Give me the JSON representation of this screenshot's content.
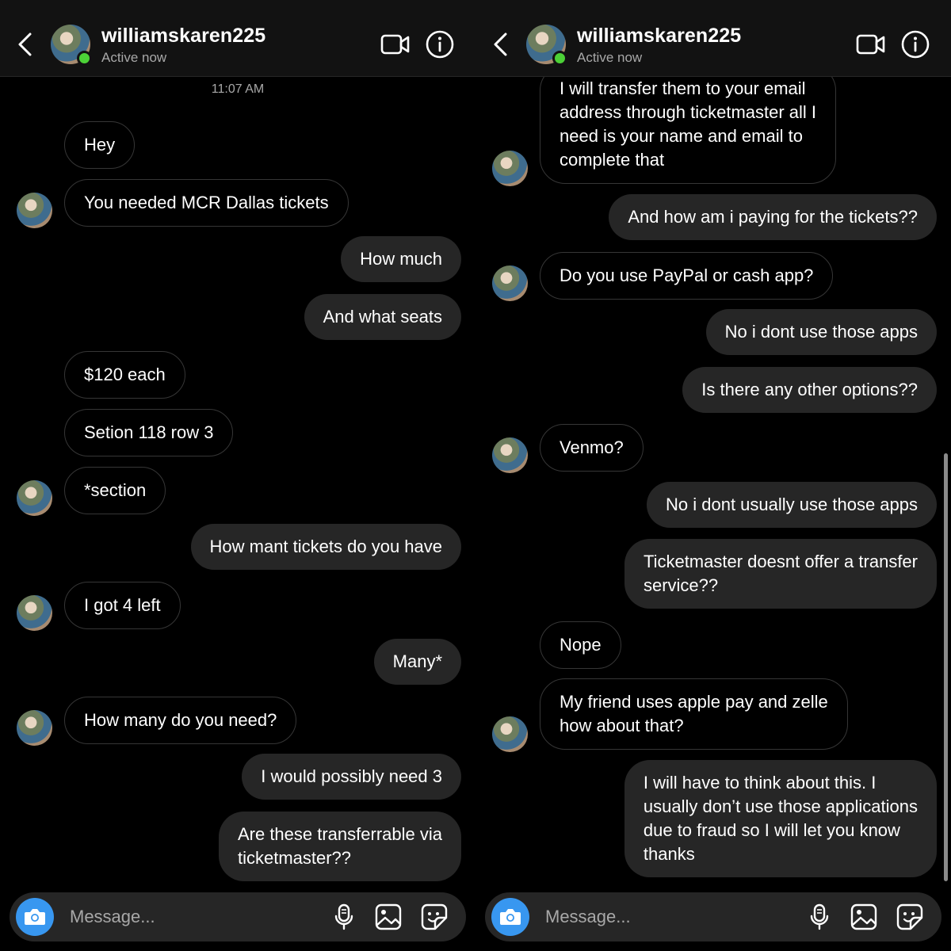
{
  "left": {
    "header": {
      "username": "williamskaren225",
      "status": "Active now"
    },
    "timestamp": "11:07 AM",
    "messages": [
      {
        "text": "Hey",
        "dir": "in"
      },
      {
        "text": "You needed MCR Dallas tickets",
        "dir": "in"
      },
      {
        "text": "How much",
        "dir": "out"
      },
      {
        "text": "And what seats",
        "dir": "out"
      },
      {
        "text": "$120 each",
        "dir": "in"
      },
      {
        "text": "Setion 118 row 3",
        "dir": "in"
      },
      {
        "text": "*section",
        "dir": "in"
      },
      {
        "text": "How mant tickets do you have",
        "dir": "out"
      },
      {
        "text": "I got 4 left",
        "dir": "in"
      },
      {
        "text": "Many*",
        "dir": "out"
      },
      {
        "text": "How many do you need?",
        "dir": "in"
      },
      {
        "text": "I would possibly need 3",
        "dir": "out"
      },
      {
        "text": "Are these transferrable via\nticketmaster??",
        "dir": "out"
      }
    ],
    "composer": {
      "placeholder": "Message..."
    }
  },
  "right": {
    "header": {
      "username": "williamskaren225",
      "status": "Active now"
    },
    "messages": [
      {
        "text": "I will transfer them to your email\naddress through ticketmaster all I\nneed is your name and email to\ncomplete that",
        "dir": "in"
      },
      {
        "text": "And how am i paying for the tickets??",
        "dir": "out"
      },
      {
        "text": "Do you use PayPal or cash app?",
        "dir": "in"
      },
      {
        "text": "No i dont use those apps",
        "dir": "out"
      },
      {
        "text": "Is there any other options??",
        "dir": "out"
      },
      {
        "text": "Venmo?",
        "dir": "in"
      },
      {
        "text": "No i dont usually use those apps",
        "dir": "out"
      },
      {
        "text": "Ticketmaster doesnt offer a transfer\nservice??",
        "dir": "out"
      },
      {
        "text": "Nope",
        "dir": "in"
      },
      {
        "text": "My friend uses apple pay and zelle\nhow about that?",
        "dir": "in"
      },
      {
        "text": "I will have to think about this. I\nusually don’t use those applications\ndue to fraud so I will let you know\nthanks",
        "dir": "out"
      }
    ],
    "composer": {
      "placeholder": "Message..."
    }
  },
  "icons": {
    "back": "chevron-left-icon",
    "video": "video-camera-icon",
    "info": "info-icon",
    "camera": "camera-icon",
    "mic": "microphone-icon",
    "gallery": "image-gallery-icon",
    "sticker": "sticker-icon"
  },
  "colors": {
    "background": "#000000",
    "header": "#121212",
    "outgoing_bubble": "#262626",
    "incoming_border": "#363636",
    "online": "#4cd137",
    "camera_button": "#3897f0",
    "secondary_text": "#a8a8a8"
  }
}
